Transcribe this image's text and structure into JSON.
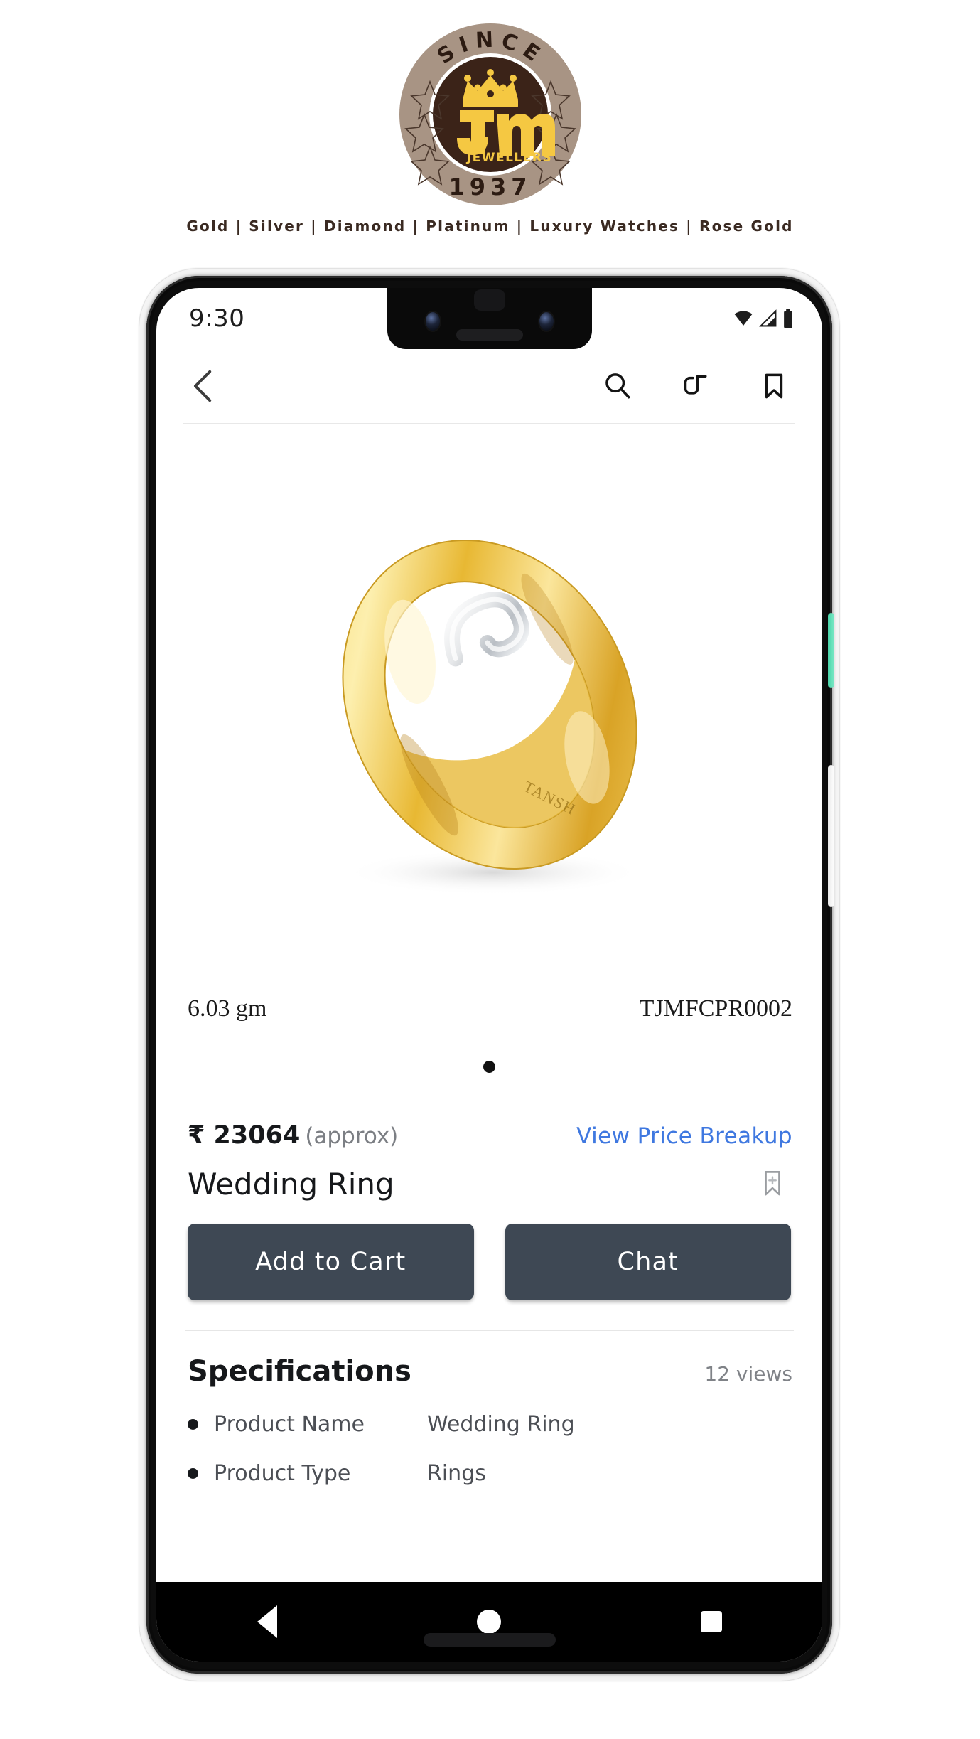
{
  "brand": {
    "logo": {
      "since_text": "SINCE",
      "year_text": "1937",
      "monogram": "Jm",
      "sub_text": "JEWELLERS",
      "ring_color": "#a89484",
      "inner_color": "#3b2318",
      "gold_color": "#f5c842"
    },
    "tagline": "Gold | Silver | Diamond | Platinum | Luxury Watches | Rose Gold"
  },
  "device": {
    "power_button_color": "#49d3a8",
    "volume_button_color": "#ffffff"
  },
  "statusbar": {
    "time": "9:30",
    "icons": [
      "wifi-icon",
      "cellular-signal-icon",
      "battery-icon"
    ]
  },
  "toolbar": {
    "back_icon": "chevron-left-icon",
    "actions": [
      {
        "name": "search-icon",
        "label": "Search"
      },
      {
        "name": "share-icon",
        "label": "Share"
      },
      {
        "name": "bookmark-icon",
        "label": "Bookmark"
      }
    ]
  },
  "product": {
    "image_alt": "gold-wedding-ring",
    "engraving": "TANSH",
    "weight": "6.03 gm",
    "sku": "TJMFCPR0002",
    "carousel": {
      "total_dots": 1,
      "active_index": 0
    },
    "price": {
      "amount": "₹ 23064",
      "approx_label": "(approx)",
      "breakup_link": "View Price Breakup",
      "link_color": "#3f78e0"
    },
    "title": "Wedding Ring",
    "save_icon": "bookmark-add-icon"
  },
  "actions": {
    "primary_label": "Add to Cart",
    "secondary_label": "Chat",
    "button_color": "#3e4854"
  },
  "specifications": {
    "heading": "Specifications",
    "views": "12 views",
    "rows": [
      {
        "key": "Product Name",
        "value": "Wedding Ring"
      },
      {
        "key": "Product Type",
        "value": "Rings"
      }
    ]
  },
  "navbar": {
    "items": [
      {
        "name": "nav-back-button",
        "label": "Back"
      },
      {
        "name": "nav-home-button",
        "label": "Home"
      },
      {
        "name": "nav-recents-button",
        "label": "Recents"
      }
    ]
  }
}
